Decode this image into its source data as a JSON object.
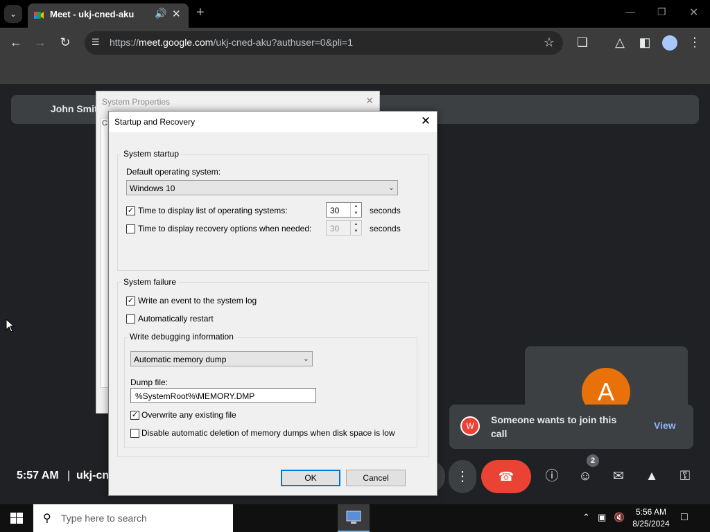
{
  "browser": {
    "tab_title": "Meet - ukj-cned-aku",
    "url_host": "meet.google.com",
    "url_prefix": "https://",
    "url_path": "/ukj-cned-aku?authuser=0&pli=1",
    "icons": {
      "tab_menu": "chevron-down-icon",
      "audio": "speaker-icon",
      "close": "close-icon",
      "new_tab": "plus-icon",
      "back": "arrow-left-icon",
      "forward": "arrow-right-icon",
      "reload": "reload-icon",
      "site_info": "tune-icon",
      "bookmark": "star-icon",
      "extensions": "puzzle-icon",
      "labs": "flask-icon",
      "side_panel": "side-panel-icon",
      "profile": "profile-icon",
      "menu": "kebab-menu-icon"
    },
    "colors": {
      "frame": "#000000",
      "toolbar": "#3c3c3c",
      "omnibox": "#282828"
    }
  },
  "meet": {
    "banner_name": "John Smit",
    "self_initial": "A",
    "toast_text": "Someone wants to join this call",
    "toast_initial": "W",
    "toast_action": "View",
    "time": "5:57 AM",
    "separator": "|",
    "meeting_code": "ukj-cn",
    "people_count": "2",
    "colors": {
      "background": "#202124",
      "leave": "#ea4335",
      "avatar": "#e8710a",
      "link": "#8ab4f8"
    },
    "icons": [
      "more-vert-icon",
      "call-end-icon",
      "info-icon",
      "people-icon",
      "chat-icon",
      "activities-icon",
      "host-controls-icon"
    ]
  },
  "system_properties": {
    "title": "System Properties",
    "tab_fragment": "C"
  },
  "dialog": {
    "title": "Startup and Recovery",
    "startup": {
      "group_label": "System startup",
      "default_os_label": "Default operating system:",
      "default_os_value": "Windows 10",
      "display_list_label": "Time to display list of operating systems:",
      "display_list_checked": true,
      "display_list_value": "30",
      "display_list_unit": "seconds",
      "recovery_label": "Time to display recovery options when needed:",
      "recovery_checked": false,
      "recovery_value": "30",
      "recovery_unit": "seconds"
    },
    "failure": {
      "group_label": "System failure",
      "write_event_label": "Write an event to the system log",
      "write_event_checked": true,
      "auto_restart_label": "Automatically restart",
      "auto_restart_checked": false,
      "debug_group_label": "Write debugging information",
      "debug_value": "Automatic memory dump",
      "dump_file_label": "Dump file:",
      "dump_file_value": "%SystemRoot%\\MEMORY.DMP",
      "overwrite_label": "Overwrite any existing file",
      "overwrite_checked": true,
      "disable_delete_label": "Disable automatic deletion of memory dumps when disk space is low",
      "disable_delete_checked": false
    },
    "ok_label": "OK",
    "cancel_label": "Cancel"
  },
  "taskbar": {
    "search_placeholder": "Type here to search",
    "clock_time": "5:56 AM",
    "clock_date": "8/25/2024",
    "icons": [
      "windows-start-icon",
      "search-icon",
      "system-properties-app-icon",
      "tray-chevron-icon",
      "network-icon",
      "volume-muted-icon",
      "notifications-icon"
    ]
  }
}
